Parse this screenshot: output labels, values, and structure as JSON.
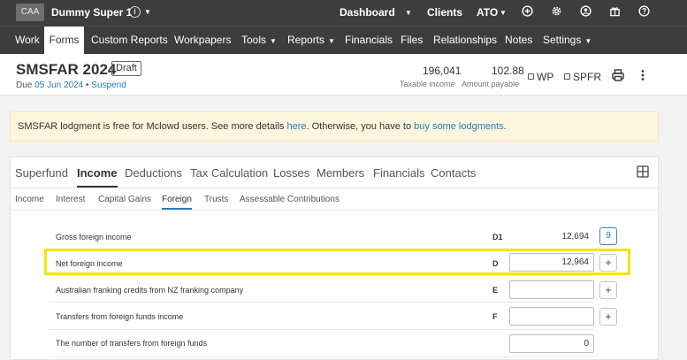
{
  "topbar": {
    "client_badge": "CAA",
    "client_name": "Dummy Super 1",
    "links": {
      "dashboard": "Dashboard",
      "clients": "Clients",
      "ato": "ATO"
    },
    "icons": [
      "plus-circle-icon",
      "gear-icon",
      "user-circle-icon",
      "gift-icon",
      "help-circle-icon"
    ]
  },
  "nav": {
    "items": [
      "Work",
      "Forms",
      "Custom Reports",
      "Workpapers",
      "Tools",
      "Reports",
      "Financials",
      "Files",
      "Relationships",
      "Notes",
      "Settings"
    ],
    "active": "Forms"
  },
  "header": {
    "title": "SMSFAR 2024",
    "status_badge": "Draft",
    "due_prefix": "Due",
    "due_date": "05 Jun 2024",
    "separator": "•",
    "suspend_link": "Suspend",
    "taxable_income_value": "196,041",
    "taxable_income_label": "Taxable income",
    "amount_payable_value": "102.88",
    "amount_payable_label": "Amount payable",
    "wp_label": "WP",
    "spfr_label": "SPFR",
    "icons": [
      "printer-icon",
      "more-vertical-icon"
    ]
  },
  "notice": {
    "text_1": "SMSFAR lodgment is free for Mclowd users. See more details ",
    "link_1": "here",
    "text_2": ". Otherwise, you have to ",
    "link_2": "buy some lodgments",
    "text_3": "."
  },
  "tabs": {
    "main": [
      "Superfund",
      "Income",
      "Deductions",
      "Tax Calculation",
      "Losses",
      "Members",
      "Financials",
      "Contacts"
    ],
    "active_main": "Income",
    "sub": [
      "Income",
      "Interest",
      "Capital Gains",
      "Foreign",
      "Trusts",
      "Assessable Contributions"
    ],
    "active_sub": "Foreign"
  },
  "rows": [
    {
      "label": "Gross foreign income",
      "code": "D1",
      "value": "12,694",
      "badge": "9"
    },
    {
      "label": "Net foreign income",
      "code": "D",
      "value": "12,964"
    },
    {
      "label": "Australian franking credits from NZ franking company",
      "code": "E",
      "value": ""
    },
    {
      "label": "Transfers from foreign funds income",
      "code": "F",
      "value": ""
    },
    {
      "label": "The number of transfers from foreign funds",
      "code": "",
      "value": "0"
    }
  ],
  "colors": {
    "topbar_bg": "#3d3d3d",
    "link": "#2a7ab8",
    "notice_bg": "#fdf6dd",
    "highlight": "#f1e80f"
  }
}
